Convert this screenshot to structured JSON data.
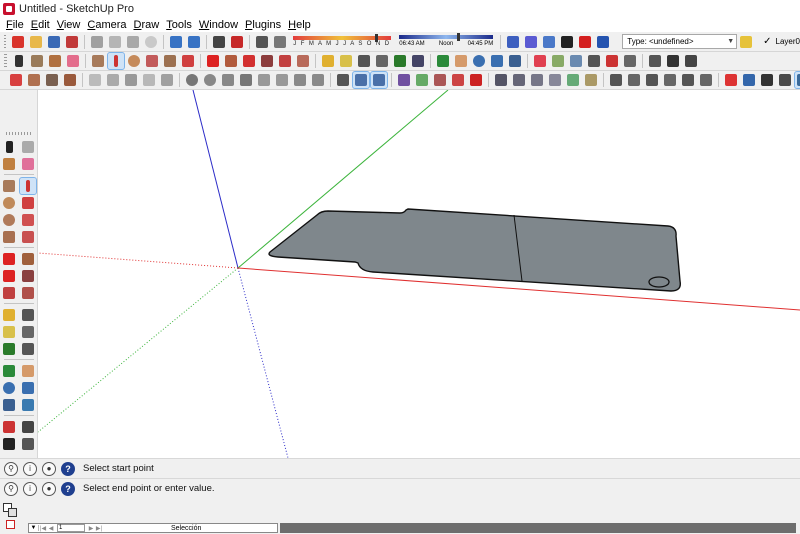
{
  "window": {
    "title": "Untitled - SketchUp Pro"
  },
  "menu": [
    "File",
    "Edit",
    "View",
    "Camera",
    "Draw",
    "Tools",
    "Window",
    "Plugins",
    "Help"
  ],
  "shadow": {
    "months": "J F M A M J J A S O N D"
  },
  "time": {
    "start": "06:43 AM",
    "noon": "Noon",
    "end": "04:45 PM"
  },
  "entity_info": {
    "type_value": "Type: <undefined>"
  },
  "layer": {
    "name": "Layer0",
    "checked": "✓"
  },
  "instructor": {
    "line1": "Select start point",
    "line2": "Select end point or enter value."
  },
  "status": {
    "page_value": "1",
    "label": "Selección"
  },
  "colors": {
    "red_axis": "#e03030",
    "green_axis": "#3cb43c",
    "blue_axis": "#2c2cc8",
    "face": "#7f878c"
  }
}
